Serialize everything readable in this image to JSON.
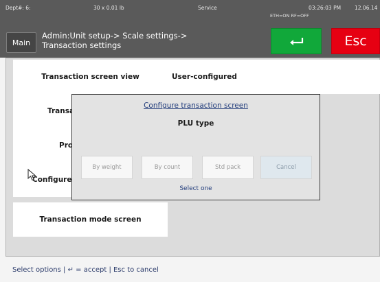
{
  "status": {
    "dept": "Dept#: 6:",
    "weight": "30 x 0.01 lb",
    "mode": "Service",
    "time": "03:26:03 PM",
    "date": "12.06.14",
    "network": "ETH=ON  RF=OFF"
  },
  "header": {
    "main_label": "Main",
    "breadcrumb_line1": "Admin:Unit setup-> Scale settings->",
    "breadcrumb_line2": "Transaction settings",
    "accept_icon": "enter-arrow-icon",
    "esc_label": "Esc"
  },
  "menu": {
    "items": [
      {
        "label": "Transaction screen view"
      },
      {
        "label": "Transac"
      },
      {
        "label": "Prog"
      },
      {
        "label": "Configure t"
      },
      {
        "label": "Transaction mode screen"
      }
    ],
    "value_0": "User-configured"
  },
  "dialog": {
    "title": "Configure transaction screen",
    "subtitle": "PLU type",
    "options": [
      "By weight",
      "By count",
      "Std pack",
      "Cancel"
    ],
    "hint": "Select one"
  },
  "footer": {
    "prefix": "Select options | ",
    "accept_symbol": "↵",
    "suffix": " = accept | Esc to cancel"
  },
  "colors": {
    "header_bg": "#5a5a5a",
    "accept_green": "#11a83a",
    "esc_red": "#e60012"
  }
}
